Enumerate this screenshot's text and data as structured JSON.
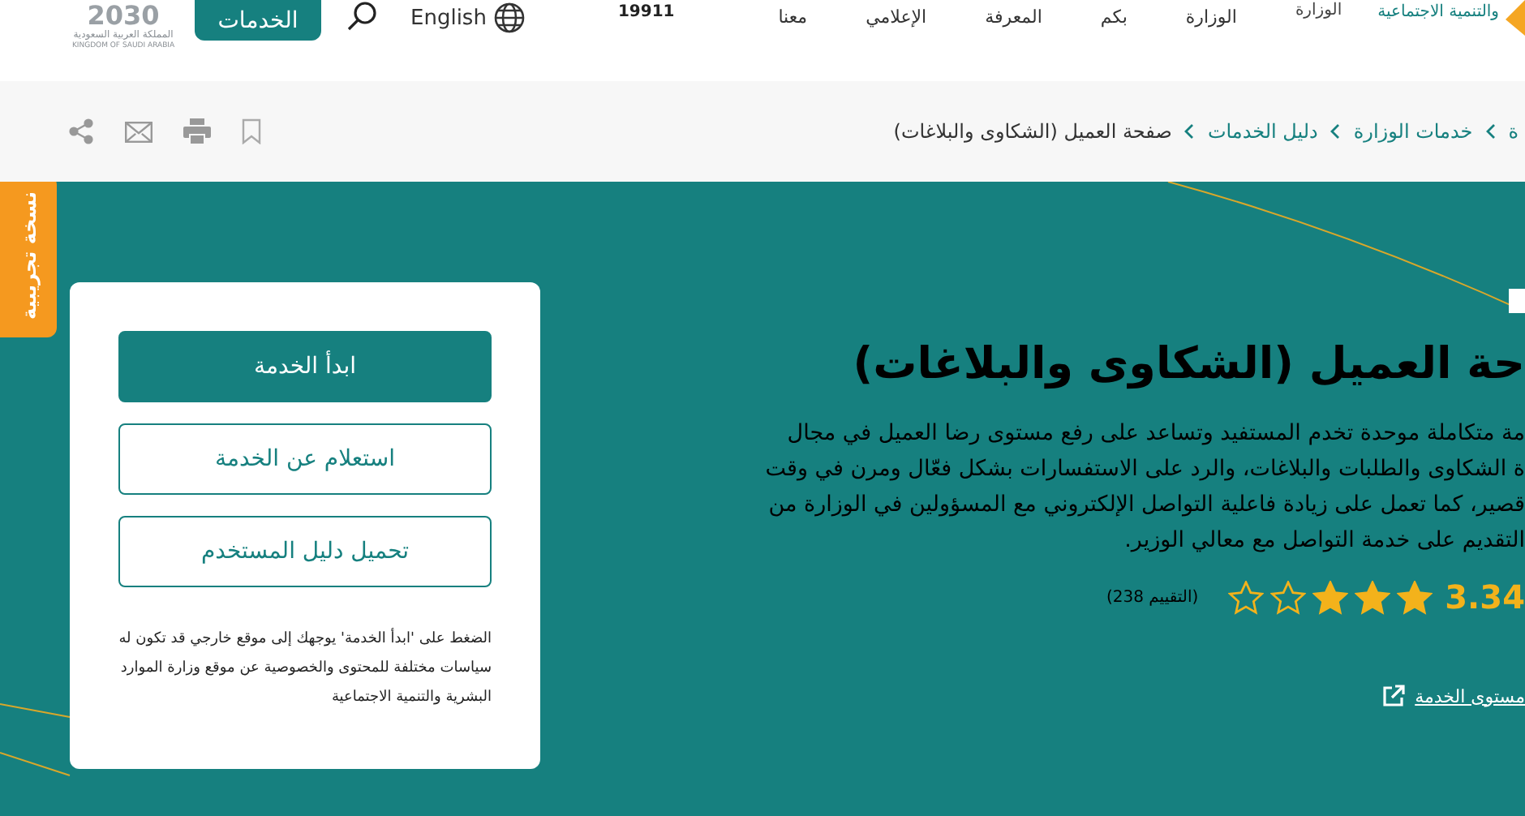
{
  "header": {
    "vision_logo": {
      "mark": "2030",
      "line_1": "المملكة العربية السعودية",
      "line_2": "KINGDOM OF SAUDI ARABIA"
    },
    "services_button": "الخدمات",
    "language": "English",
    "hotline": "19911",
    "nav": [
      {
        "label": "الوزارة",
        "kind": "raised"
      },
      {
        "label": "الوزارة",
        "kind": "item"
      },
      {
        "label": "بكم",
        "kind": "item"
      },
      {
        "label": "المعرفة",
        "kind": "item"
      },
      {
        "label": "الإعلامي",
        "kind": "item"
      },
      {
        "label": "معنا",
        "kind": "item"
      }
    ],
    "ministry_name": "والتنمية الاجتماعية"
  },
  "breadcrumb": [
    "ة",
    "خدمات الوزارة",
    "دليل الخدمات",
    "صفحة العميل (الشكاوى والبلاغات)"
  ],
  "beta_tab": "نسخة تجريبية",
  "service": {
    "title": "حة العميل (الشكاوى والبلاغات)",
    "description": [
      "مة متكاملة موحدة تخدم المستفيد وتساعد على رفع مستوى رضا العميل في مجال",
      "ة الشكاوى والطلبات والبلاغات، والرد على الاستفسارات بشكل فعّال ومرن في وقت",
      "قصير، كما تعمل على زيادة فاعلية التواصل الإلكتروني مع المسؤولين في الوزارة من",
      "التقديم على خدمة التواصل مع معالي الوزير."
    ],
    "rating": {
      "score": "3.34",
      "stars": 3,
      "count": "(التقييم 238)"
    },
    "link": "مستوى الخدمة"
  },
  "actions": {
    "buttons": [
      {
        "label": "ابدأ الخدمة",
        "kind": "primary"
      },
      {
        "label": "استعلام عن الخدمة",
        "kind": "outline"
      },
      {
        "label": "تحميل دليل المستخدم",
        "kind": "outline"
      }
    ],
    "note": "الضغط على 'ابدأ الخدمة' يوجهك إلى موقع خارجي قد تكون له سياسات مختلفة للمحتوى والخصوصية عن موقع وزارة الموارد البشرية والتنمية الاجتماعية"
  }
}
